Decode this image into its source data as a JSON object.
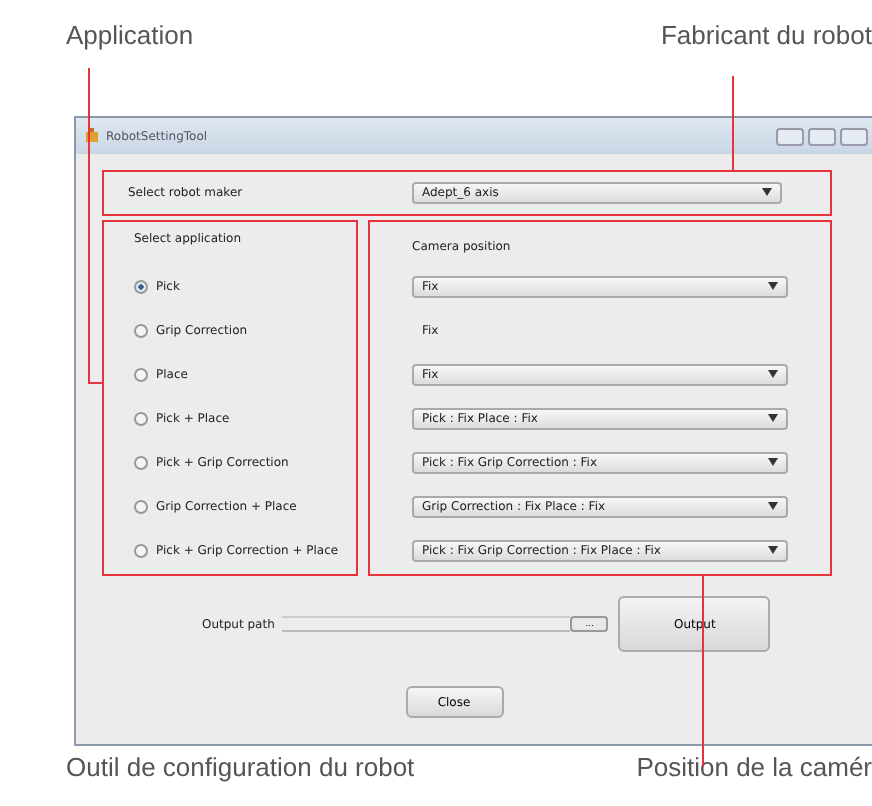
{
  "callouts": {
    "top_left": "Application",
    "top_right": "Fabricant du robot",
    "bottom_left": "Outil de configuration du robot",
    "bottom_right": "Position de la camér"
  },
  "window": {
    "title": "RobotSettingTool"
  },
  "maker": {
    "label": "Select robot maker",
    "value": "Adept_6 axis"
  },
  "application": {
    "title": "Select application"
  },
  "camera": {
    "title": "Camera position"
  },
  "rows": [
    {
      "label": "Pick",
      "selected": true,
      "camera": {
        "kind": "dropdown",
        "value": "Fix"
      }
    },
    {
      "label": "Grip Correction",
      "selected": false,
      "camera": {
        "kind": "text",
        "value": "Fix"
      }
    },
    {
      "label": "Place",
      "selected": false,
      "camera": {
        "kind": "dropdown",
        "value": "Fix"
      }
    },
    {
      "label": "Pick + Place",
      "selected": false,
      "camera": {
        "kind": "dropdown",
        "value": "Pick : Fix  Place : Fix"
      }
    },
    {
      "label": "Pick + Grip Correction",
      "selected": false,
      "camera": {
        "kind": "dropdown",
        "value": "Pick : Fix  Grip Correction : Fix"
      }
    },
    {
      "label": "Grip Correction + Place",
      "selected": false,
      "camera": {
        "kind": "dropdown",
        "value": "Grip Correction : Fix  Place : Fix"
      }
    },
    {
      "label": "Pick + Grip Correction + Place",
      "selected": false,
      "camera": {
        "kind": "dropdown",
        "value": "Pick : Fix  Grip Correction : Fix  Place : Fix"
      }
    }
  ],
  "output": {
    "label": "Output path",
    "browse": "...",
    "button": "Output"
  },
  "close": "Close"
}
